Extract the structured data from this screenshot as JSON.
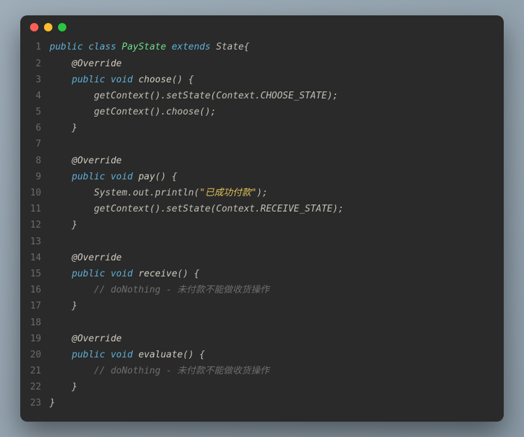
{
  "traffic_lights": {
    "close": "#ff5f57",
    "min": "#febc2e",
    "max": "#28c840"
  },
  "colors": {
    "kw": "#5fb0d6",
    "class": "#6fdc8c",
    "ann": "#d0ccc0",
    "fn": "#d0ccc0",
    "ident": "#c3bfb5",
    "punct": "#c3bfb5",
    "str": "#e0c35a",
    "cmt": "#6e6e6e"
  },
  "line_numbers": [
    "1",
    "2",
    "3",
    "4",
    "5",
    "6",
    "7",
    "8",
    "9",
    "10",
    "11",
    "12",
    "13",
    "14",
    "15",
    "16",
    "17",
    "18",
    "19",
    "20",
    "21",
    "22",
    "23"
  ],
  "code": [
    [
      [
        "kw",
        "public"
      ],
      [
        "punct",
        " "
      ],
      [
        "kw",
        "class"
      ],
      [
        "punct",
        " "
      ],
      [
        "class",
        "PayState"
      ],
      [
        "punct",
        " "
      ],
      [
        "kw",
        "extends"
      ],
      [
        "punct",
        " "
      ],
      [
        "ident",
        "State"
      ],
      [
        "punct",
        "{"
      ]
    ],
    [
      [
        "punct",
        "    "
      ],
      [
        "ann",
        "@Override"
      ]
    ],
    [
      [
        "punct",
        "    "
      ],
      [
        "kw",
        "public"
      ],
      [
        "punct",
        " "
      ],
      [
        "type",
        "void"
      ],
      [
        "punct",
        " "
      ],
      [
        "fn",
        "choose"
      ],
      [
        "punct",
        "() {"
      ]
    ],
    [
      [
        "punct",
        "        "
      ],
      [
        "ident",
        "getContext"
      ],
      [
        "punct",
        "()."
      ],
      [
        "ident",
        "setState"
      ],
      [
        "punct",
        "("
      ],
      [
        "ident",
        "Context"
      ],
      [
        "punct",
        "."
      ],
      [
        "const",
        "CHOOSE_STATE"
      ],
      [
        "punct",
        ");"
      ]
    ],
    [
      [
        "punct",
        "        "
      ],
      [
        "ident",
        "getContext"
      ],
      [
        "punct",
        "()."
      ],
      [
        "ident",
        "choose"
      ],
      [
        "punct",
        "();"
      ]
    ],
    [
      [
        "punct",
        "    }"
      ]
    ],
    [],
    [
      [
        "punct",
        "    "
      ],
      [
        "ann",
        "@Override"
      ]
    ],
    [
      [
        "punct",
        "    "
      ],
      [
        "kw",
        "public"
      ],
      [
        "punct",
        " "
      ],
      [
        "type",
        "void"
      ],
      [
        "punct",
        " "
      ],
      [
        "fn",
        "pay"
      ],
      [
        "punct",
        "() {"
      ]
    ],
    [
      [
        "punct",
        "        "
      ],
      [
        "ident",
        "System"
      ],
      [
        "punct",
        "."
      ],
      [
        "ident",
        "out"
      ],
      [
        "punct",
        "."
      ],
      [
        "ident",
        "println"
      ],
      [
        "punct",
        "("
      ],
      [
        "str",
        "\"已成功付款\""
      ],
      [
        "punct",
        ");"
      ]
    ],
    [
      [
        "punct",
        "        "
      ],
      [
        "ident",
        "getContext"
      ],
      [
        "punct",
        "()."
      ],
      [
        "ident",
        "setState"
      ],
      [
        "punct",
        "("
      ],
      [
        "ident",
        "Context"
      ],
      [
        "punct",
        "."
      ],
      [
        "const",
        "RECEIVE_STATE"
      ],
      [
        "punct",
        ");"
      ]
    ],
    [
      [
        "punct",
        "    }"
      ]
    ],
    [],
    [
      [
        "punct",
        "    "
      ],
      [
        "ann",
        "@Override"
      ]
    ],
    [
      [
        "punct",
        "    "
      ],
      [
        "kw",
        "public"
      ],
      [
        "punct",
        " "
      ],
      [
        "type",
        "void"
      ],
      [
        "punct",
        " "
      ],
      [
        "fn",
        "receive"
      ],
      [
        "punct",
        "() {"
      ]
    ],
    [
      [
        "punct",
        "        "
      ],
      [
        "cmt",
        "// doNothing - 未付款不能做收货操作"
      ]
    ],
    [
      [
        "punct",
        "    }"
      ]
    ],
    [],
    [
      [
        "punct",
        "    "
      ],
      [
        "ann",
        "@Override"
      ]
    ],
    [
      [
        "punct",
        "    "
      ],
      [
        "kw",
        "public"
      ],
      [
        "punct",
        " "
      ],
      [
        "type",
        "void"
      ],
      [
        "punct",
        " "
      ],
      [
        "fn",
        "evaluate"
      ],
      [
        "punct",
        "() {"
      ]
    ],
    [
      [
        "punct",
        "        "
      ],
      [
        "cmt",
        "// doNothing - 未付款不能做收货操作"
      ]
    ],
    [
      [
        "punct",
        "    }"
      ]
    ],
    [
      [
        "punct",
        "}"
      ]
    ]
  ]
}
